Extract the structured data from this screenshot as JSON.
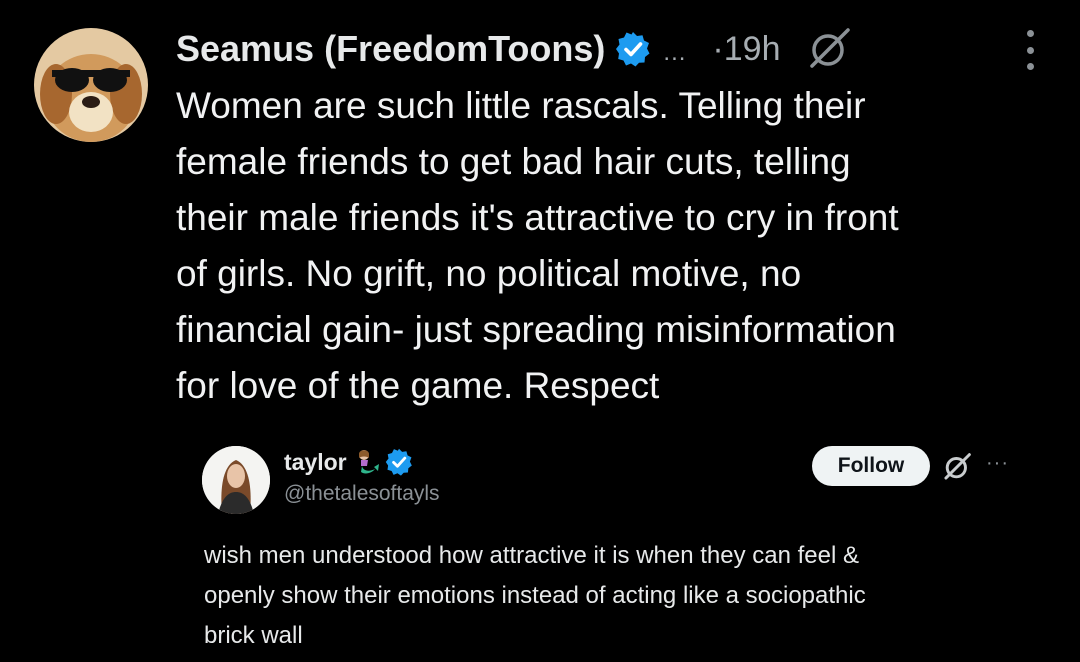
{
  "post": {
    "display_name": "Seamus (FreedomToons)",
    "name_overflow": "...",
    "time": "·19h",
    "text": "Women are such little rascals. Telling their\nfemale friends to get bad hair cuts, telling\ntheir male friends it's attractive to cry in front\nof girls. No grift, no political motive, no\nfinancial gain- just spreading misinformation\nfor love of the game. Respect"
  },
  "quoted": {
    "display_name": "taylor",
    "handle": "@thetalesoftayls",
    "follow_label": "Follow",
    "more": "···",
    "text": "wish men understood how attractive it is when they can feel &\nopenly show their emotions instead of acting like a sociopathic\nbrick wall"
  },
  "icons": {
    "main_avatar": "dog-with-sunglasses-avatar",
    "verified": "verified-badge-icon",
    "grok": "grok-icon",
    "more": "more-vertical-icon",
    "quote_avatar": "woman-avatar",
    "mermaid": "mermaid-emoji-icon"
  },
  "colors": {
    "background": "#000000",
    "text": "#e7e9ea",
    "muted": "#8b9196",
    "verified": "#1d9bf0",
    "follow_bg": "#eff3f4"
  }
}
